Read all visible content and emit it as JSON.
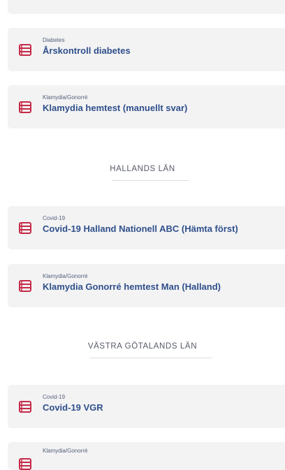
{
  "cards": [
    {
      "category": "",
      "title": ""
    },
    {
      "category": "Diabetes",
      "title": "Årskontroll diabetes"
    },
    {
      "category": "Klamydia/Gonorré",
      "title": "Klamydia hemtest (manuellt svar)"
    },
    {
      "category": "Covid-19",
      "title": "Covid-19 Halland Nationell ABC (Hämta först)"
    },
    {
      "category": "Klamydia/Gonorré",
      "title": "Klamydia Gonorré hemtest Man (Halland)"
    },
    {
      "category": "Covid-19",
      "title": "Covid-19 VGR"
    },
    {
      "category": "Klamydia/Gonorré",
      "title": ""
    }
  ],
  "sections": [
    {
      "label": "HALLANDS LÄN"
    },
    {
      "label": "VÄSTRA GÖTALANDS LÄN"
    }
  ],
  "icon": {
    "name": "test-kit-icon",
    "color": "#c62a47"
  },
  "colors": {
    "card_bg": "#f3f3f4",
    "title": "#2f4f8a",
    "category": "#55607a",
    "section_label": "#555a66"
  }
}
